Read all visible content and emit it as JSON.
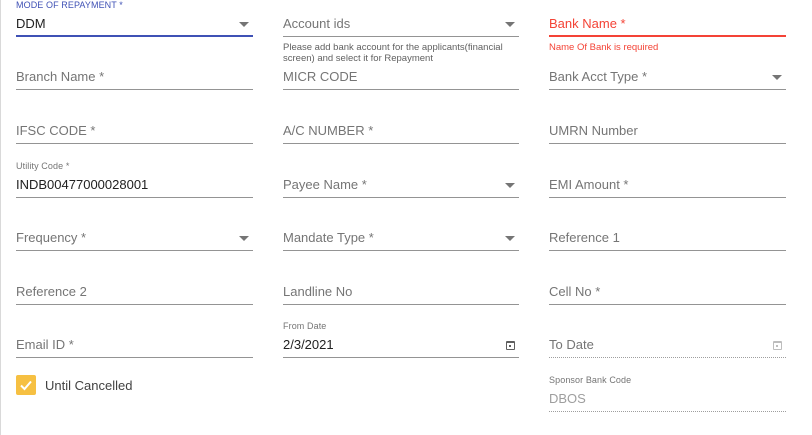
{
  "form": {
    "mode_of_repayment": {
      "label": "MODE OF REPAYMENT *",
      "value": "DDM"
    },
    "account_ids": {
      "label": "Account ids",
      "hint": "Please add bank account for the applicants(financial screen) and select it for Repayment"
    },
    "bank_name": {
      "label": "Bank Name *",
      "error": "Name Of Bank is required"
    },
    "branch_name": {
      "label": "Branch Name  *"
    },
    "micr_code": {
      "label": "MICR CODE"
    },
    "bank_acct_type": {
      "label": "Bank Acct Type *"
    },
    "ifsc_code": {
      "label": "IFSC CODE *"
    },
    "ac_number": {
      "label": "A/C NUMBER *"
    },
    "umrn_number": {
      "label": "UMRN Number"
    },
    "utility_code": {
      "label": "Utility Code *",
      "value": "INDB00477000028001"
    },
    "payee_name": {
      "label": "Payee Name *"
    },
    "emi_amount": {
      "label": "EMI Amount *"
    },
    "frequency": {
      "label": "Frequency *"
    },
    "mandate_type": {
      "label": "Mandate Type *"
    },
    "reference_1": {
      "label": "Reference 1"
    },
    "reference_2": {
      "label": "Reference 2"
    },
    "landline_no": {
      "label": "Landline No"
    },
    "cell_no": {
      "label": "Cell No *"
    },
    "email_id": {
      "label": "Email ID *"
    },
    "from_date": {
      "label": "From Date",
      "value": "2/3/2021"
    },
    "to_date": {
      "label": "To Date"
    },
    "until_cancelled": {
      "label": "Until Cancelled",
      "checked": true
    },
    "sponsor_bank_code": {
      "label": "Sponsor Bank Code",
      "value": "DBOS"
    }
  },
  "colors": {
    "accent": "#3f51b5",
    "error": "#f44336",
    "checkbox": "#f6c042"
  }
}
